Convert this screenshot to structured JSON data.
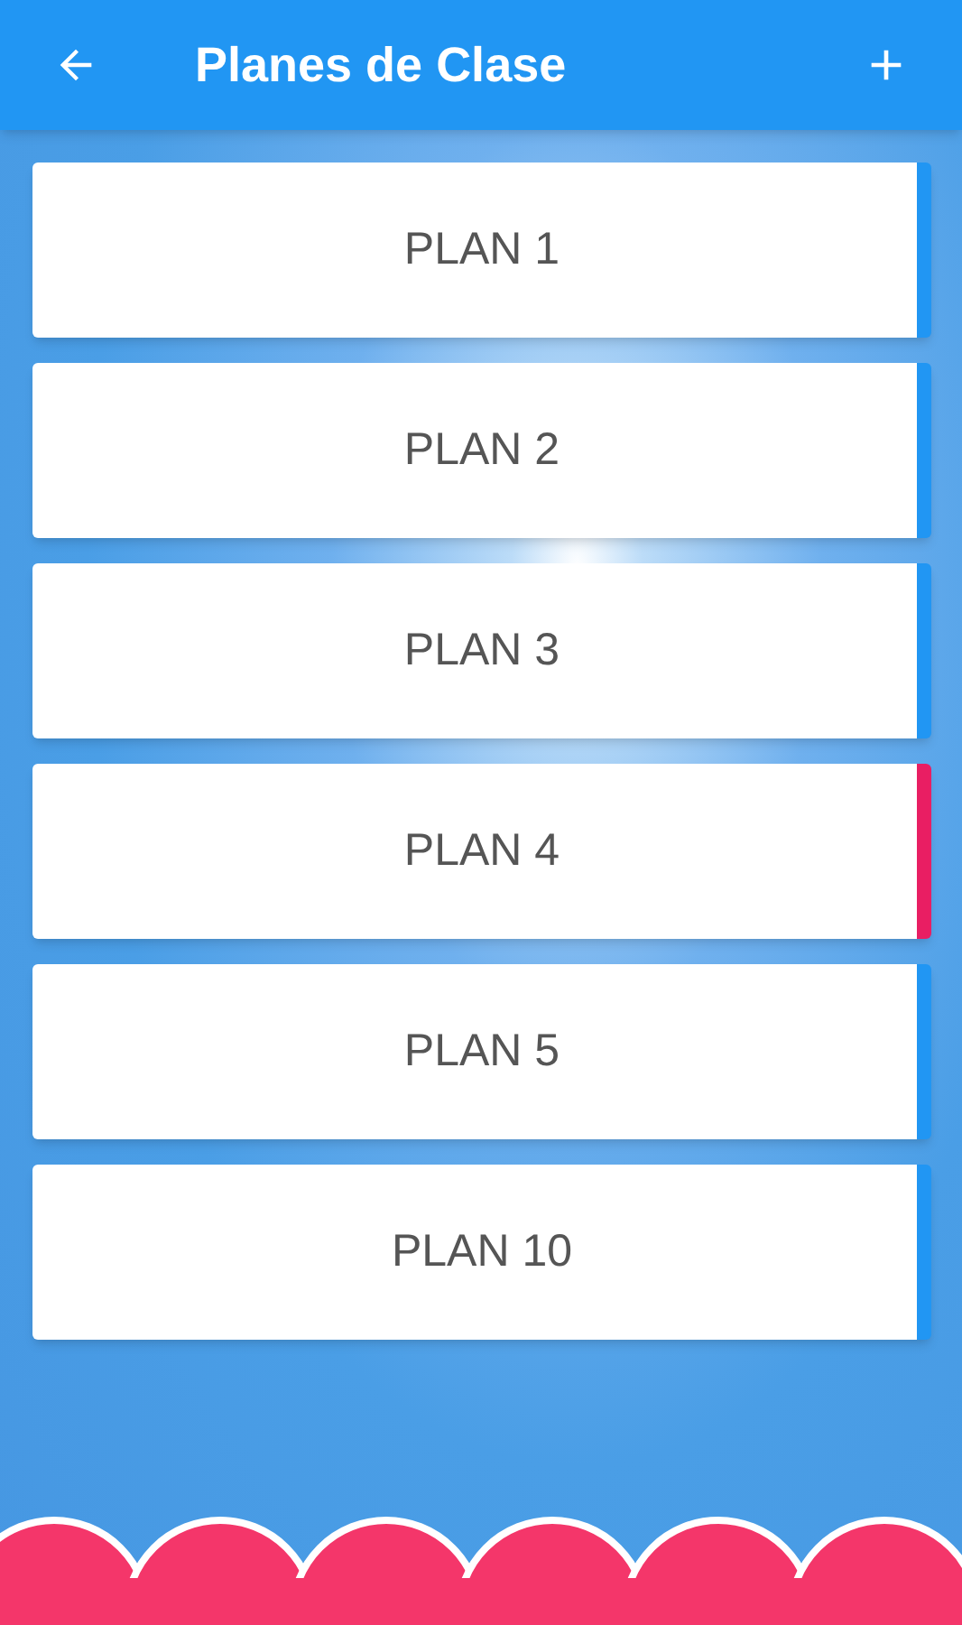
{
  "app_bar": {
    "title": "Planes de Clase"
  },
  "plans": [
    {
      "label": "PLAN 1",
      "selected": false
    },
    {
      "label": "PLAN 2",
      "selected": false
    },
    {
      "label": "PLAN 3",
      "selected": false
    },
    {
      "label": "PLAN 4",
      "selected": true
    },
    {
      "label": "PLAN 5",
      "selected": false
    },
    {
      "label": "PLAN 10",
      "selected": false
    }
  ]
}
